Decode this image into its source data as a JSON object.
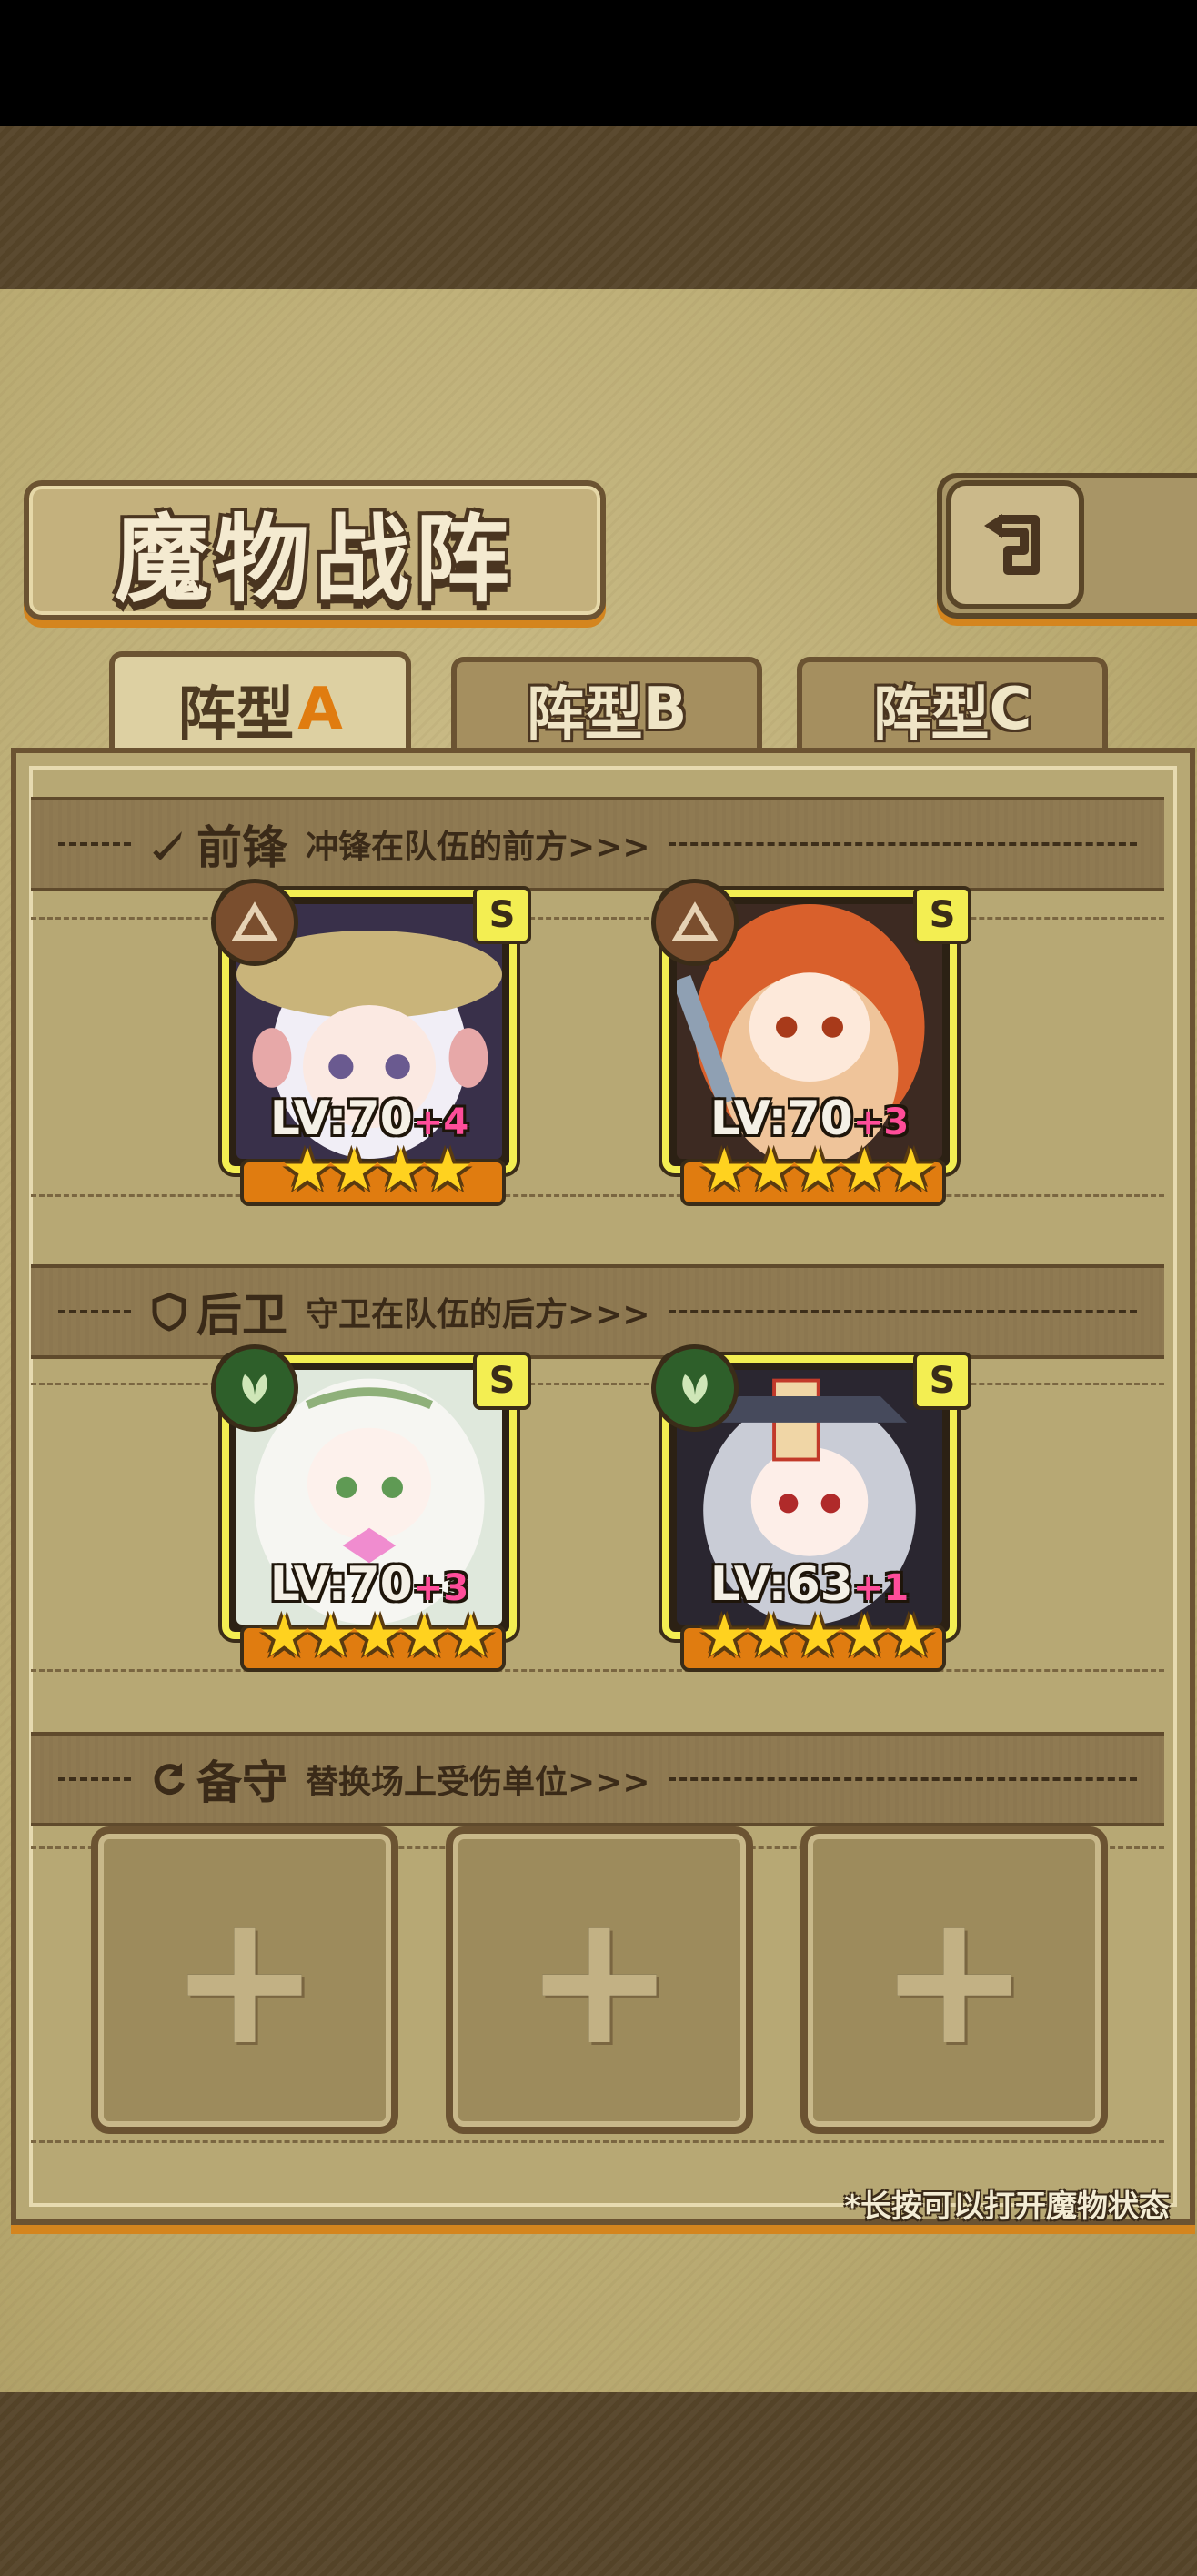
{
  "screen": {
    "title": "魔物战阵"
  },
  "tabs": [
    {
      "label": "阵型",
      "letter": "A",
      "active": true
    },
    {
      "label": "阵型",
      "letter": "B",
      "active": false
    },
    {
      "label": "阵型",
      "letter": "C",
      "active": false
    }
  ],
  "sections": {
    "front": {
      "title": "前锋",
      "desc": "冲锋在队伍的前方>>>",
      "icon": "sword-icon"
    },
    "back": {
      "title": "后卫",
      "desc": "守卫在队伍的后方>>>",
      "icon": "shield-icon"
    },
    "reserve": {
      "title": "备守",
      "desc": "替换场上受伤单位>>>",
      "icon": "rotate-icon"
    }
  },
  "front_units": [
    {
      "grade": "S",
      "element": "earth",
      "lv": "LV:70",
      "plus": "+4",
      "stars": 4,
      "star_text": "★★★★"
    },
    {
      "grade": "S",
      "element": "earth",
      "lv": "LV:70",
      "plus": "+3",
      "stars": 5,
      "star_text": "★★★★★"
    }
  ],
  "back_units": [
    {
      "grade": "S",
      "element": "leaf",
      "lv": "LV:70",
      "plus": "+3",
      "stars": 5,
      "star_text": "★★★★★"
    },
    {
      "grade": "S",
      "element": "leaf",
      "lv": "LV:63",
      "plus": "+1",
      "stars": 5,
      "star_text": "★★★★★"
    }
  ],
  "reserve_slots": [
    "+",
    "+",
    "+"
  ],
  "hint": "*长按可以打开魔物状态",
  "colors": {
    "accent": "#e07c10",
    "frame": "#f3ee52",
    "plus": "#ff4d9a",
    "star": "#ffd21f"
  }
}
